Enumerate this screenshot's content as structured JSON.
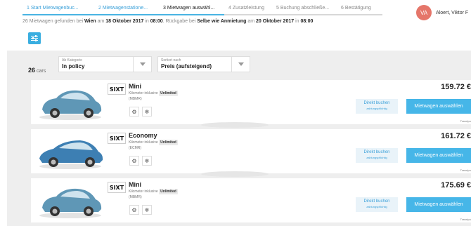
{
  "steps": [
    {
      "label": "1  Start Mietwagenbuc...",
      "state": "done"
    },
    {
      "label": "2  Mietwagenstatione...",
      "state": "done"
    },
    {
      "label": "3  Mietwagen auswähl...",
      "state": "active"
    },
    {
      "label": "4  Zusatzleistung",
      "state": "todo"
    },
    {
      "label": "5  Buchung abschließe...",
      "state": "todo"
    },
    {
      "label": "6  Bestätigung",
      "state": "todo"
    }
  ],
  "user": {
    "initials": "VA",
    "name": "Aloert, Viktor F"
  },
  "summary": {
    "prefix": "26 Mietwagen gefunden bei ",
    "city": "Wien",
    "mid1": " am ",
    "pickup_date": "18 Oktober 2017",
    "mid2": " in ",
    "pickup_time": "08:00",
    "mid3": ". Rückgabe bei ",
    "return_place": "Selbe wie Anmietung",
    "mid4": " am ",
    "return_date": "20 Oktober 2017",
    "mid5": " in ",
    "return_time": "08:00"
  },
  "count": {
    "number": "26",
    "unit": "cars"
  },
  "filters": {
    "category": {
      "caption": "Ab Kategorie",
      "value": "In policy"
    },
    "sort": {
      "caption": "Sortiert nach",
      "value": "Preis (aufsteigend)"
    }
  },
  "cars": [
    {
      "category": "Mini",
      "km_text": "Kilometer inklusive",
      "km_badge": "Unlimited",
      "code": "(MBMR)",
      "price": "159.72 €",
      "logo": "SIXT",
      "color": "#5f97b6"
    },
    {
      "category": "Economy",
      "km_text": "Kilometer inklusive",
      "km_badge": "Unlimited",
      "code": "(ECMR)",
      "price": "161.72 €",
      "logo": "SIXT",
      "color": "#3d7fb3"
    },
    {
      "category": "Mini",
      "km_text": "Kilometer inklusive",
      "km_badge": "Unlimited",
      "code": "(MBMR)",
      "price": "175.69 €",
      "logo": "SIXT",
      "color": "#5f97b6"
    }
  ],
  "buttons": {
    "direct": "Direkt buchen",
    "direct_sub": "zahlungspflichtig",
    "choose": "Mietwagen auswählen"
  },
  "provider": "Travelpo",
  "accent": "#46b6e8"
}
